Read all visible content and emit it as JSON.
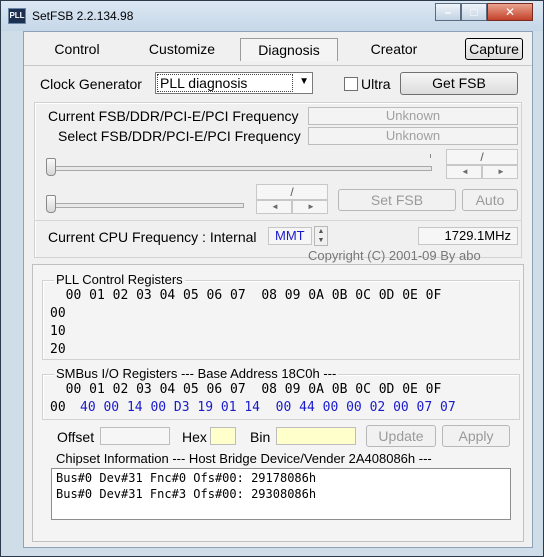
{
  "window": {
    "title": "SetFSB 2.2.134.98",
    "icon_text": "PLL"
  },
  "tabs": [
    {
      "label": "Control"
    },
    {
      "label": "Customize"
    },
    {
      "label": "Diagnosis"
    },
    {
      "label": "Creator"
    }
  ],
  "capture_label": "Capture",
  "clock": {
    "label": "Clock Generator",
    "selected": "PLL diagnosis",
    "ultra_label": "Ultra",
    "get_fsb_label": "Get FSB"
  },
  "fsb": {
    "current_label": "Current FSB/DDR/PCI-E/PCI Frequency",
    "current_value": "Unknown",
    "select_label": "Select FSB/DDR/PCI-E/PCI Frequency",
    "select_value": "Unknown",
    "set_fsb_label": "Set FSB",
    "auto_label": "Auto",
    "spin1_sep": "/",
    "spin2_sep": "/"
  },
  "cpu": {
    "label": "Current CPU Frequency : Internal",
    "mode": "MMT",
    "value": "1729.1MHz",
    "copyright": "Copyright (C) 2001-09 By abo"
  },
  "pll": {
    "title": "PLL Control Registers",
    "header": "  00 01 02 03 04 05 06 07  08 09 0A 0B 0C 0D 0E 0F",
    "rows": [
      "00",
      "10",
      "20"
    ]
  },
  "smbus": {
    "title": "SMBus I/O Registers  --- Base Address 18C0h ---",
    "header": "  00 01 02 03 04 05 06 07  08 09 0A 0B 0C 0D 0E 0F",
    "row_label": "00",
    "row_values": "40 00 14 00 D3 19 01 14  00 44 00 00 02 00 07 07"
  },
  "offset": {
    "offset_label": "Offset",
    "hex_label": "Hex",
    "bin_label": "Bin",
    "update_label": "Update",
    "apply_label": "Apply"
  },
  "chipset": {
    "title": "Chipset Information  --- Host Bridge Device/Vender 2A408086h ---",
    "lines": [
      "Bus#0 Dev#31 Fnc#0 Ofs#00: 29178086h",
      "Bus#0 Dev#31 Fnc#3 Ofs#00: 29308086h"
    ]
  },
  "colors": {
    "accent_blue": "#1a1acb",
    "hex_field": "#ffffcc"
  }
}
